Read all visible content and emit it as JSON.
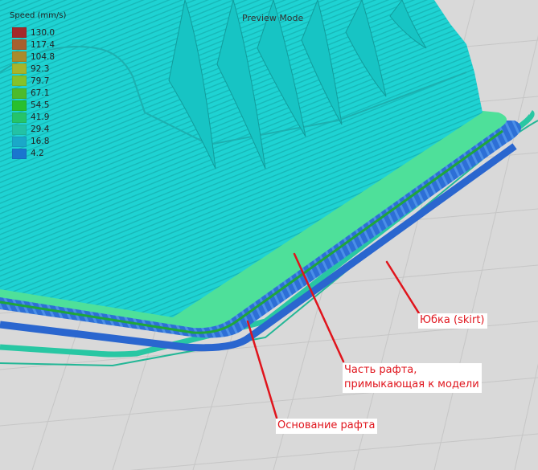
{
  "viewport": {
    "mode_label": "Preview Mode"
  },
  "legend": {
    "title": "Speed (mm/s)",
    "items": [
      {
        "value": "130.0",
        "color": "#a5282a"
      },
      {
        "value": "117.4",
        "color": "#a7602e"
      },
      {
        "value": "104.8",
        "color": "#a98b2c"
      },
      {
        "value": "92.3",
        "color": "#a7b52b"
      },
      {
        "value": "79.7",
        "color": "#85c22a"
      },
      {
        "value": "67.1",
        "color": "#4cbb2c"
      },
      {
        "value": "54.5",
        "color": "#28c02e"
      },
      {
        "value": "41.9",
        "color": "#24c46a"
      },
      {
        "value": "29.4",
        "color": "#22c2a6"
      },
      {
        "value": "16.8",
        "color": "#1aa8c9"
      },
      {
        "value": "4.2",
        "color": "#1a76cf"
      }
    ]
  },
  "annotations": {
    "skirt": "Юбка (skirt)",
    "raft_interface_line1": "Часть рафта,",
    "raft_interface_line2": "примыкающая к модели",
    "raft_base": "Основание рафта"
  },
  "colors": {
    "model": "#1ed3d3",
    "raft_top": "#4ee09a",
    "raft_base": "#3c7fe0",
    "skirt": "#28c7a3",
    "annotation": "#e0141c",
    "build_plate": "#d9d9d9",
    "grid_line": "#c6c6c6"
  }
}
